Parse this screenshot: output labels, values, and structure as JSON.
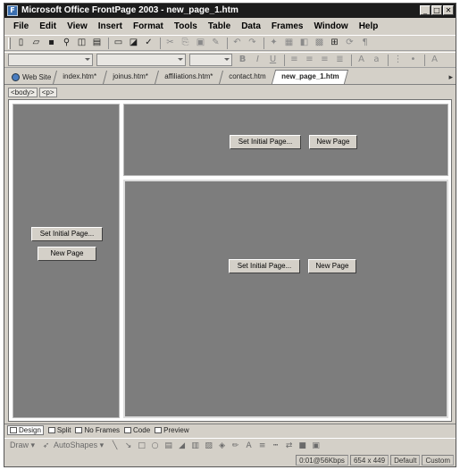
{
  "window": {
    "title": "Microsoft Office FrontPage 2003 - new_page_1.htm",
    "controls": [
      "_",
      "□",
      "✕"
    ]
  },
  "menubar": [
    "File",
    "Edit",
    "View",
    "Insert",
    "Format",
    "Tools",
    "Table",
    "Data",
    "Frames",
    "Window",
    "Help"
  ],
  "tabs": {
    "website": "Web Site",
    "pages": [
      {
        "label": "index.htm*"
      },
      {
        "label": "joinus.htm*"
      },
      {
        "label": "affiliations.htm*"
      },
      {
        "label": "contact.htm"
      },
      {
        "label": "new_page_1.htm"
      }
    ],
    "scroll_glyph": "▸"
  },
  "tagbar": [
    "<body>",
    "<p>"
  ],
  "frames": {
    "left": {
      "set_initial": "Set Initial Page...",
      "new_page": "New Page"
    },
    "top": {
      "set_initial": "Set Initial Page...",
      "new_page": "New Page"
    },
    "main": {
      "set_initial": "Set Initial Page...",
      "new_page": "New Page"
    }
  },
  "view_tabs": [
    "Design",
    "Split",
    "No Frames",
    "Code",
    "Preview"
  ],
  "drawbar": {
    "draw": "Draw ▾",
    "autoshapes": "AutoShapes ▾"
  },
  "status": {
    "speed": "0:01@56Kbps",
    "dimensions": "654 x 449",
    "mode": "Default",
    "custom": "Custom"
  }
}
